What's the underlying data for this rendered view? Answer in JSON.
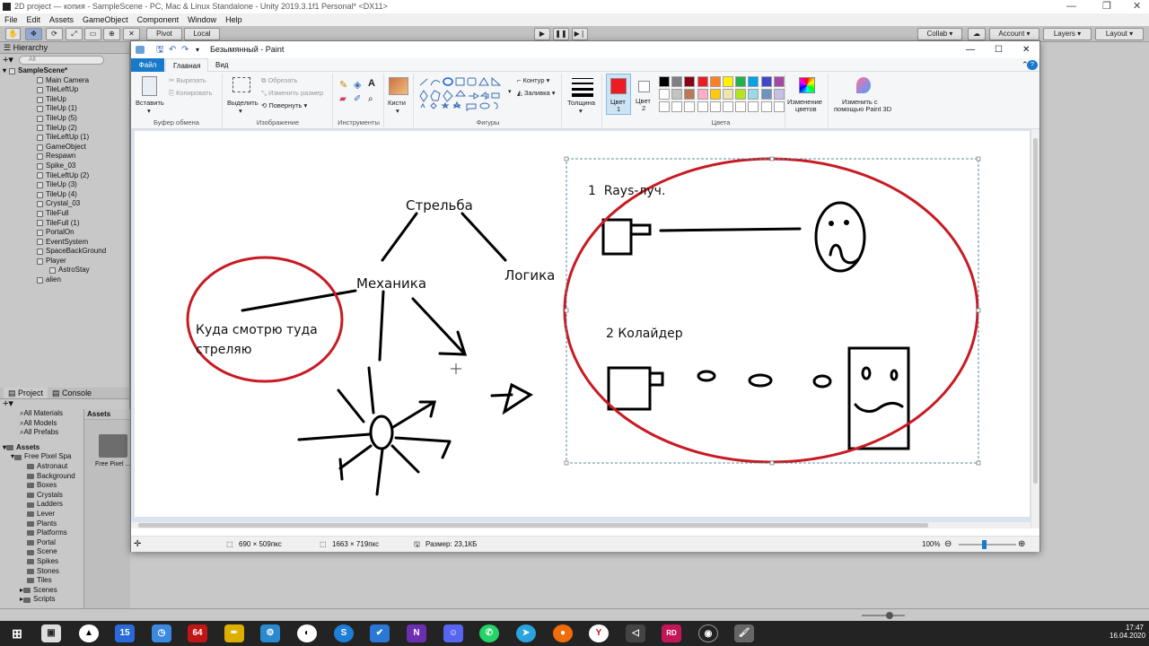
{
  "unity": {
    "title": "2D project — копия - SampleScene - PC, Mac & Linux Standalone - Unity 2019.3.1f1 Personal* <DX11>",
    "menu": [
      "File",
      "Edit",
      "Assets",
      "GameObject",
      "Component",
      "Window",
      "Help"
    ],
    "toolbar": {
      "pivot": "Pivot",
      "local": "Local",
      "collab": "Collab ▾",
      "account": "Account ▾",
      "layers": "Layers",
      "layout": "Layout"
    },
    "hierarchy": {
      "tab": "Hierarchy",
      "search_placeholder": "All",
      "scene": "SampleScene*",
      "items": [
        {
          "name": "Main Camera",
          "indent": 1
        },
        {
          "name": "TileLeftUp",
          "indent": 1
        },
        {
          "name": "TileUp",
          "indent": 1
        },
        {
          "name": "TileUp (1)",
          "indent": 1
        },
        {
          "name": "TileUp (5)",
          "indent": 1
        },
        {
          "name": "TileUp (2)",
          "indent": 1
        },
        {
          "name": "TileLeftUp (1)",
          "indent": 1
        },
        {
          "name": "GameObject",
          "indent": 1
        },
        {
          "name": "Respawn",
          "indent": 1
        },
        {
          "name": "Spike_03",
          "indent": 1
        },
        {
          "name": "TileLeftUp (2)",
          "indent": 1
        },
        {
          "name": "TileUp (3)",
          "indent": 1
        },
        {
          "name": "TileUp (4)",
          "indent": 1
        },
        {
          "name": "Crystal_03",
          "indent": 1
        },
        {
          "name": "TileFull",
          "indent": 1
        },
        {
          "name": "TileFull (1)",
          "indent": 1
        },
        {
          "name": "PortalOn",
          "indent": 1
        },
        {
          "name": "EventSystem",
          "indent": 1
        },
        {
          "name": "SpaceBackGround",
          "indent": 1
        },
        {
          "name": "Player",
          "indent": 1
        },
        {
          "name": "AstroStay",
          "indent": 2
        },
        {
          "name": "alien",
          "indent": 1
        }
      ]
    },
    "project": {
      "tab_project": "Project",
      "tab_console": "Console",
      "favorites": [
        "All Materials",
        "All Models",
        "All Prefabs"
      ],
      "assets_root": "Assets",
      "folders": [
        "Free Pixel Spa",
        "Astronaut",
        "Background",
        "Boxes",
        "Crystals",
        "Ladders",
        "Lever",
        "Plants",
        "Platforms",
        "Portal",
        "Scene",
        "Spikes",
        "Stones",
        "Tiles",
        "Scenes",
        "Scripts"
      ],
      "assets_header": "Assets",
      "asset_item": "Free Pixel ..."
    }
  },
  "paint": {
    "title": "Безымянный - Paint",
    "tabs": {
      "file": "Файл",
      "home": "Главная",
      "view": "Вид"
    },
    "ribbon": {
      "paste": "Вставить",
      "cut": "Вырезать",
      "copy": "Копировать",
      "clipboard": "Буфер обмена",
      "select": "Выделить",
      "crop": "Обрезать",
      "resize": "Изменить размер",
      "rotate": "Повернуть ▾",
      "image": "Изображение",
      "tools": "Инструменты",
      "brushes": "Кисти",
      "outline": "Контур ▾",
      "fill": "Заливка ▾",
      "shapes": "Фигуры",
      "size": "Толщина",
      "color1": "Цвет",
      "color1_num": "1",
      "color2": "Цвет",
      "color2_num": "2",
      "colors": "Цвета",
      "edit_colors_1": "Изменение",
      "edit_colors_2": "цветов",
      "paint3d_1": "Изменить с",
      "paint3d_2": "помощью Paint 3D"
    },
    "palette": [
      "#000000",
      "#7f7f7f",
      "#880015",
      "#ed1c24",
      "#ff7f27",
      "#fff200",
      "#22b14c",
      "#00a2e8",
      "#3f48cc",
      "#a349a4",
      "#ffffff",
      "#c3c3c3",
      "#b97a57",
      "#ffaec9",
      "#ffc90e",
      "#efe4b0",
      "#b5e61d",
      "#99d9ea",
      "#7092be",
      "#c8bfe7"
    ],
    "accent": "#ed1c24",
    "status": {
      "cursor": "690 × 509пкс",
      "canvas_size": "1663 × 719пкс",
      "file_size": "Размер: 23,1КБ",
      "zoom": "100%"
    },
    "drawing": {
      "shooting": "Стрельба",
      "mechanics": "Механика",
      "logic": "Логика",
      "aim_1": "Куда смотрю туда",
      "aim_2": "стреляю",
      "rays": "1  Rays-луч.",
      "collider": "2 Колайдер"
    }
  },
  "taskbar": {
    "time": "17:47",
    "date": "16.04.2020"
  }
}
